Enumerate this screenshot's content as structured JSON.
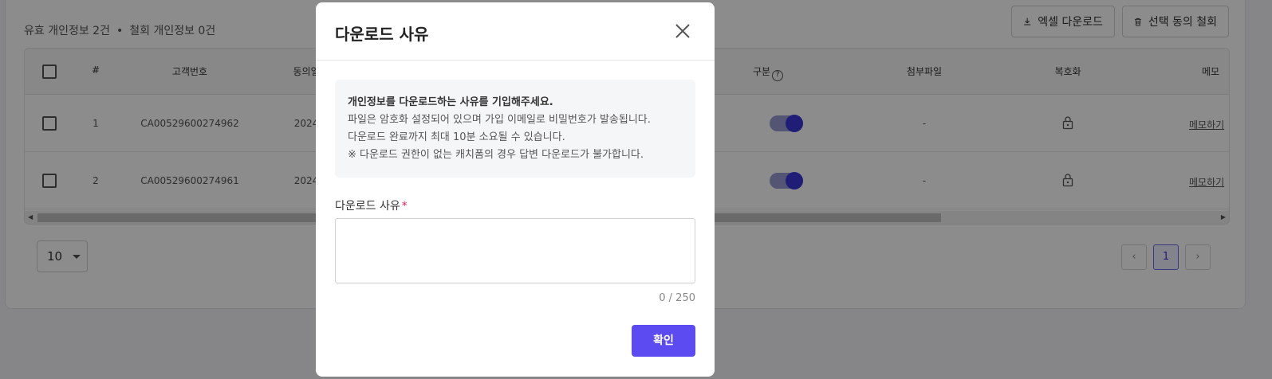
{
  "summary": {
    "valid_label": "유효 개인정보 2건",
    "separator": "•",
    "withdrawn_label": "철회 개인정보 0건"
  },
  "toolbar": {
    "excel_label": "엑셀 다운로드",
    "withdraw_label": "선택 동의 철회"
  },
  "table": {
    "headers": {
      "index": "#",
      "customer_no": "고객번호",
      "consent": "동의일",
      "type": "구분",
      "attachment": "첨부파일",
      "decrypt": "복호화",
      "memo": "메모"
    },
    "rows": [
      {
        "index": "1",
        "customer_no": "CA00529600274962",
        "date": "2024",
        "attachment": "-",
        "toggle_on": true,
        "memo": "메모하기"
      },
      {
        "index": "2",
        "customer_no": "CA00529600274961",
        "date": "2024",
        "attachment": "-",
        "toggle_on": true,
        "memo": "메모하기"
      }
    ]
  },
  "pagination": {
    "page_size": "10",
    "current_page": "1"
  },
  "modal": {
    "title": "다운로드 사유",
    "info_lines": [
      "개인정보를 다운로드하는 사유를 기입해주세요.",
      "파일은 암호화 설정되어 있으며 가입 이메일로 비밀번호가 발송됩니다.",
      "다운로드 완료까지 최대 10분 소요될 수 있습니다.",
      "※ 다운로드 권한이 없는 캐치폼의 경우 답변 다운로드가 불가합니다."
    ],
    "field_label": "다운로드 사유",
    "required_mark": "*",
    "reason_value": "",
    "counter": "0 / 250",
    "confirm_label": "확인"
  },
  "colors": {
    "accent": "#5b4bf0",
    "toggle_knob": "#3b35d9",
    "required": "#e0245e"
  }
}
